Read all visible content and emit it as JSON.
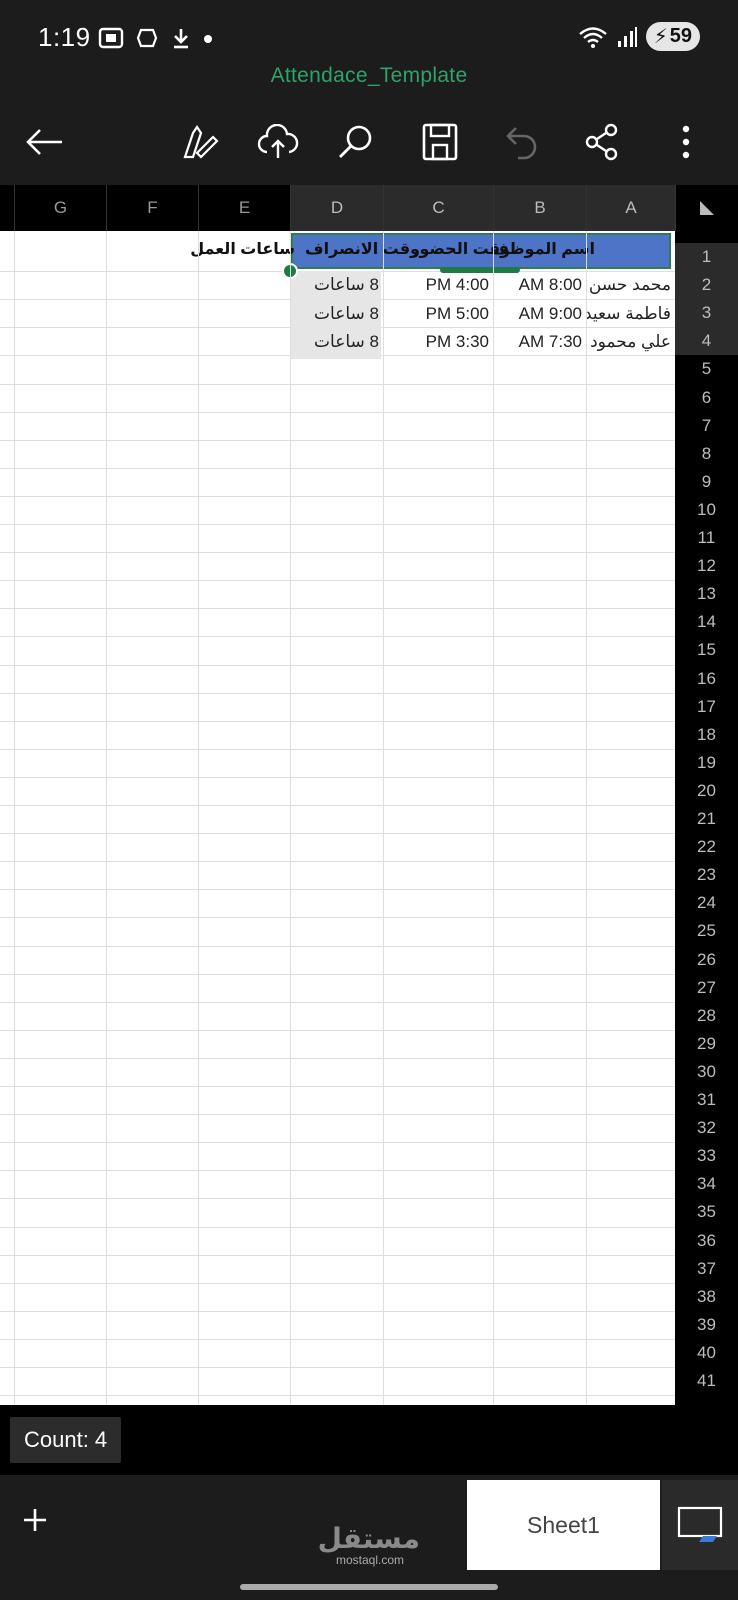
{
  "status": {
    "time": "1:19",
    "battery": "59"
  },
  "document": {
    "title": "Attendace_Template"
  },
  "toolbar": {
    "back": "back-arrow-icon",
    "edit": "draw-icon",
    "upload": "cloud-upload-icon",
    "search": "search-icon",
    "save": "save-icon",
    "undo": "undo-icon",
    "share": "share-icon",
    "more": "more-icon"
  },
  "columns": [
    "G",
    "F",
    "E",
    "D",
    "C",
    "B",
    "A"
  ],
  "rows": [
    "1",
    "2",
    "3",
    "4",
    "5",
    "6",
    "7",
    "8",
    "9",
    "10",
    "11",
    "12",
    "13",
    "14",
    "15",
    "16",
    "17",
    "18",
    "19",
    "20",
    "21",
    "22",
    "23",
    "24",
    "25",
    "26",
    "27",
    "28",
    "29",
    "30",
    "31",
    "32",
    "33",
    "34",
    "35",
    "36",
    "37",
    "38",
    "39",
    "40",
    "41"
  ],
  "table": {
    "headers": {
      "A": "اسم الموظف",
      "B": "وقت الحضور",
      "C": "وقت الانصراف",
      "D": "ساعات العمل"
    },
    "rows": [
      {
        "A": "محمد حسن",
        "B": "8:00 AM",
        "C": "4:00 PM",
        "D": "8 ساعات"
      },
      {
        "A": "فاطمة سعيد",
        "B": "9:00 AM",
        "C": "5:00 PM",
        "D": "8 ساعات"
      },
      {
        "A": "علي محمود",
        "B": "7:30 AM",
        "C": "3:30 PM",
        "D": "8 ساعات"
      }
    ]
  },
  "status_bar": {
    "count": "Count: 4"
  },
  "tabs": {
    "sheet1": "Sheet1"
  },
  "watermark": {
    "arabic": "مستقل",
    "latin": "mostaql.com"
  },
  "colors": {
    "accent": "#2ea36a",
    "header_fill": "#4e74c8",
    "selection": "#1e7b45"
  }
}
